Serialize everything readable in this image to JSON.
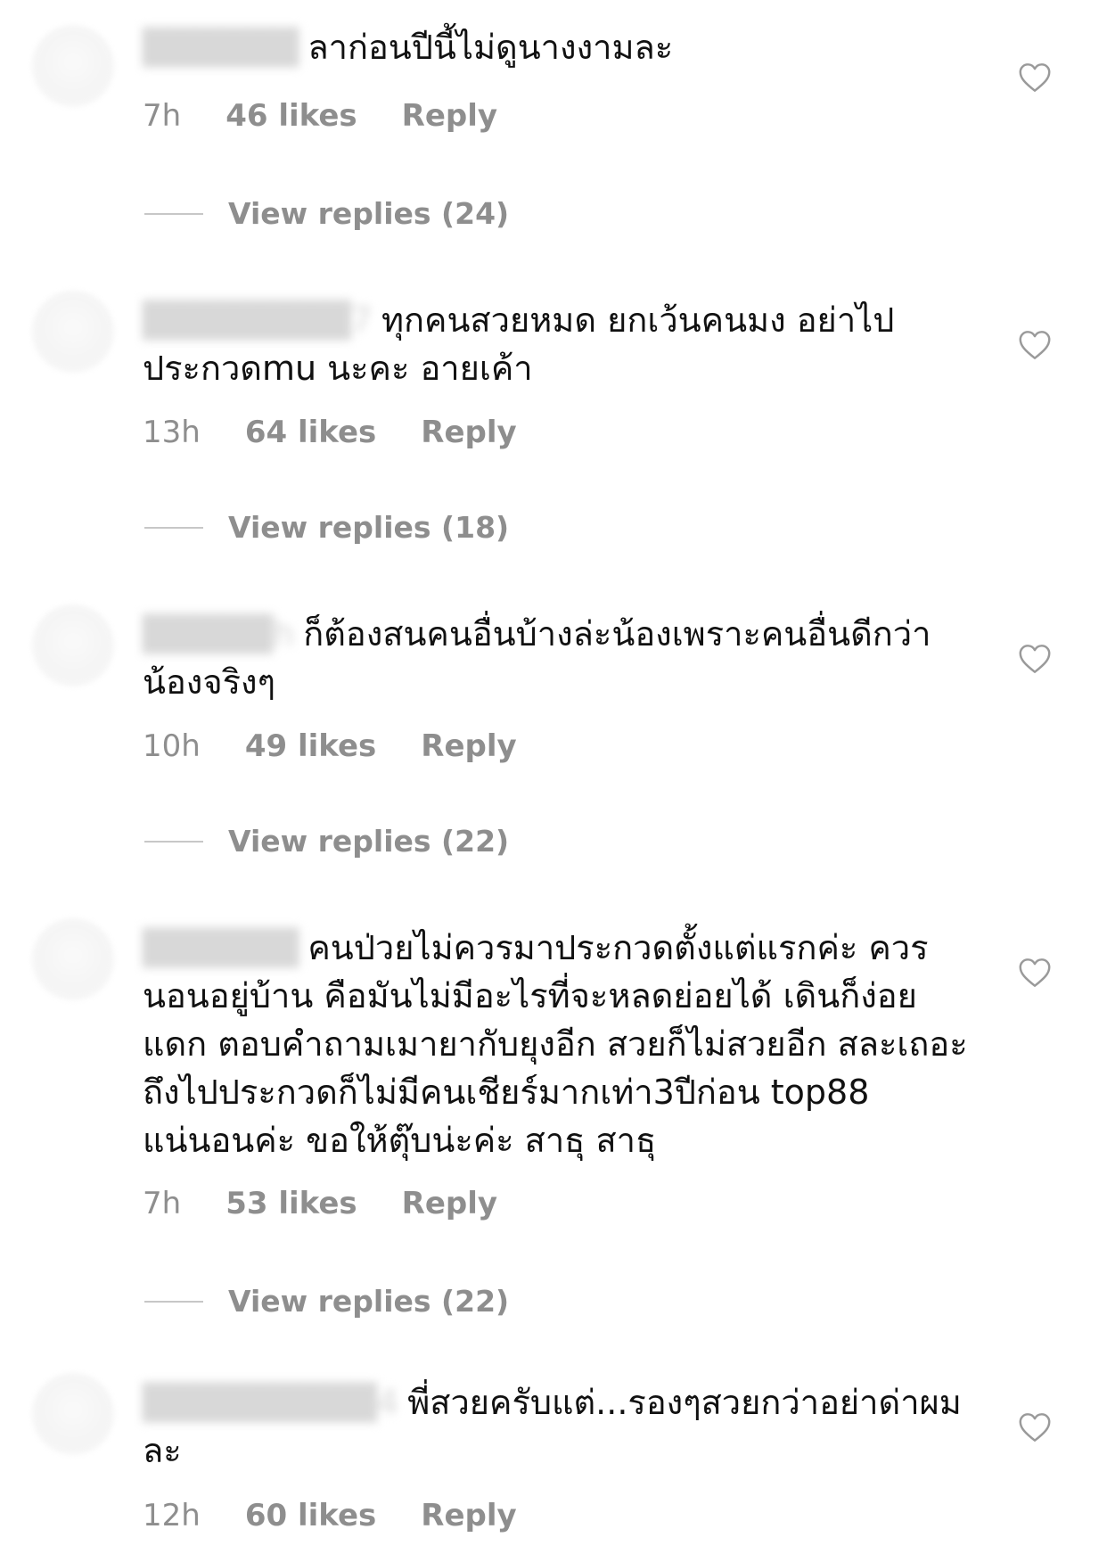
{
  "comments": [
    {
      "username": "██████",
      "text": "ลาก่อนปีนี้ไม่ดูนางงามละ",
      "time": "7h",
      "likes": "46 likes",
      "reply_label": "Reply",
      "view_replies": "View replies (24)"
    },
    {
      "username": "████████7",
      "text": "ทุกคนสวยหมด ยกเว้นคนมง อย่าไปประกวดmu นะคะ อายเค้า",
      "time": "13h",
      "likes": "64 likes",
      "reply_label": "Reply",
      "view_replies": "View replies (18)"
    },
    {
      "username": "█████h",
      "text": "ก็ต้องสนคนอื่นบ้างล่ะน้องเพราะคนอื่นดีกว่าน้องจริงๆ",
      "time": "10h",
      "likes": "49 likes",
      "reply_label": "Reply",
      "view_replies": "View replies (22)"
    },
    {
      "username": "██████",
      "text": "คนป่วยไม่ควรมาประกวดตั้งแต่แรกค่ะ ควรนอนอยู่บ้าน คือมันไม่มีอะไรที่จะหลดย่อยได้ เดินก็ง่อยแดก ตอบคำถามเมายากับยุงอีก สวยก็ไม่สวยอีก สละเถอะ ถึงไปประกวดก็ไม่มีคนเชียร์มากเท่า3ปีก่อน top88 แน่นอนค่ะ ขอให้ตุ๊บน่ะค่ะ สาธุ สาธุ",
      "time": "7h",
      "likes": "53 likes",
      "reply_label": "Reply",
      "view_replies": "View replies (22)"
    },
    {
      "username": "█████████4",
      "text": "พี่สวยครับแต่...รองๆสวยกว่าอย่าด่าผมละ",
      "time": "12h",
      "likes": "60 likes",
      "reply_label": "Reply",
      "view_replies": ""
    }
  ],
  "icons": {
    "like": "heart-outline-icon"
  },
  "colors": {
    "text": "#111111",
    "muted": "#8e8e8e",
    "divider": "#c7c7c7"
  }
}
